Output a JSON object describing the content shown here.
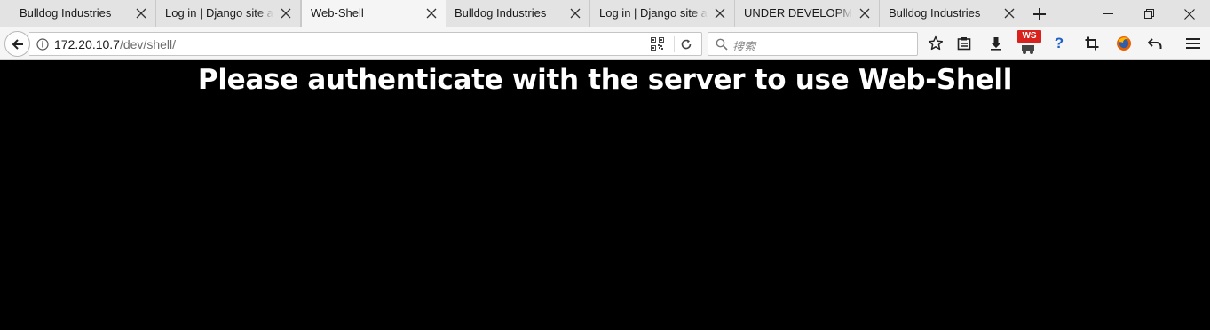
{
  "tabs": [
    {
      "label": "Bulldog Industries",
      "active": false
    },
    {
      "label": "Log in | Django site admin",
      "active": false
    },
    {
      "label": "Web-Shell",
      "active": true
    },
    {
      "label": "Bulldog Industries",
      "active": false
    },
    {
      "label": "Log in | Django site admin",
      "active": false
    },
    {
      "label": "UNDER DEVELOPMENT",
      "active": false
    },
    {
      "label": "Bulldog Industries",
      "active": false
    }
  ],
  "address": {
    "host": "172.20.10.7",
    "path": "/dev/shell/"
  },
  "search": {
    "placeholder": "搜索"
  },
  "toolbar": {
    "ws_badge": "WS",
    "help_label": "?"
  },
  "page": {
    "heading": "Please authenticate with the server to use Web-Shell"
  },
  "colors": {
    "page_background": "#000000",
    "heading_text": "#ffffff",
    "badge": "#d9221d",
    "help": "#1e62c9"
  }
}
